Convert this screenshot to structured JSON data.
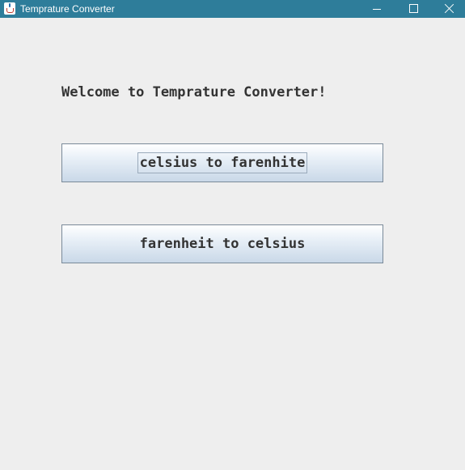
{
  "window": {
    "title": "Temprature Converter",
    "titlebar_color": "#2e7d9a",
    "background_color": "#eeeeee",
    "app_icon": "java-cup-icon",
    "controls": {
      "minimize_icon": "minimize-icon",
      "maximize_icon": "maximize-icon",
      "close_icon": "close-icon"
    }
  },
  "main": {
    "welcome_text": "Welcome to Temprature Converter!",
    "buttons": [
      {
        "label": "celsius to farenhite",
        "focused": true
      },
      {
        "label": "farenheit to celsius",
        "focused": false
      }
    ]
  }
}
